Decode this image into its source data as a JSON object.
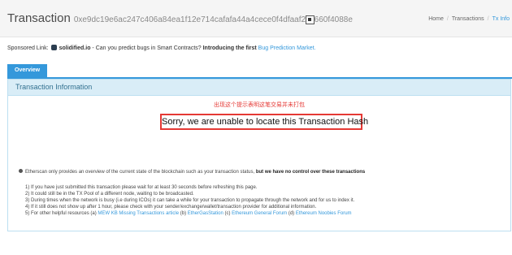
{
  "header": {
    "title": "Transaction",
    "hash": "0xe9dc19e6ac247c406a84ea1f12e714cafafa44a4cece0f4dfaaf22c660f4088e",
    "breadcrumb": [
      "Home",
      "Transactions",
      "Tx Info"
    ]
  },
  "sponsored": {
    "label": "Sponsored Link:",
    "brand": "solidified.io",
    "text": " - Can you predict bugs in Smart Contracts? ",
    "strong": "Introducing the first ",
    "link": "Bug Prediction Market."
  },
  "tabs": {
    "overview": "Overview"
  },
  "panel": {
    "title": "Transaction Information",
    "notice_cn": "出现这个提示表明这笔交易并未打包",
    "error": "Sorry, we are unable to locate this Transaction Hash"
  },
  "info": {
    "text": "Etherscan only provides an overview of the current state of the blockchain such as your transaction status, ",
    "strong": "but we have no control over these transactions"
  },
  "list": {
    "items": [
      "1) If you have just submitted this transaction please wait for at least 30 seconds before refreshing this page.",
      "2) It could still be in the TX Pool of a different node, waiting to be broadcasted.",
      "3) During times when the network is busy (i.e during ICOs) it can take a while for your transaction to propagate through the network and for us to index it.",
      "4) If it still does not show up after 1 hour, please check with your sender/exchange/wallet/transaction provider for additional information."
    ],
    "item5_prefix": "5) For other helpful resources (a) ",
    "item5_link_a": "MEW KB Missing Transactions article",
    "item5_b": " (b) ",
    "item5_link_b": "EtherGasStation",
    "item5_c": " (c) ",
    "item5_link_c": "Ethereum General Forum",
    "item5_d": " (d) ",
    "item5_link_d": "Ethereum Noobies Forum"
  }
}
